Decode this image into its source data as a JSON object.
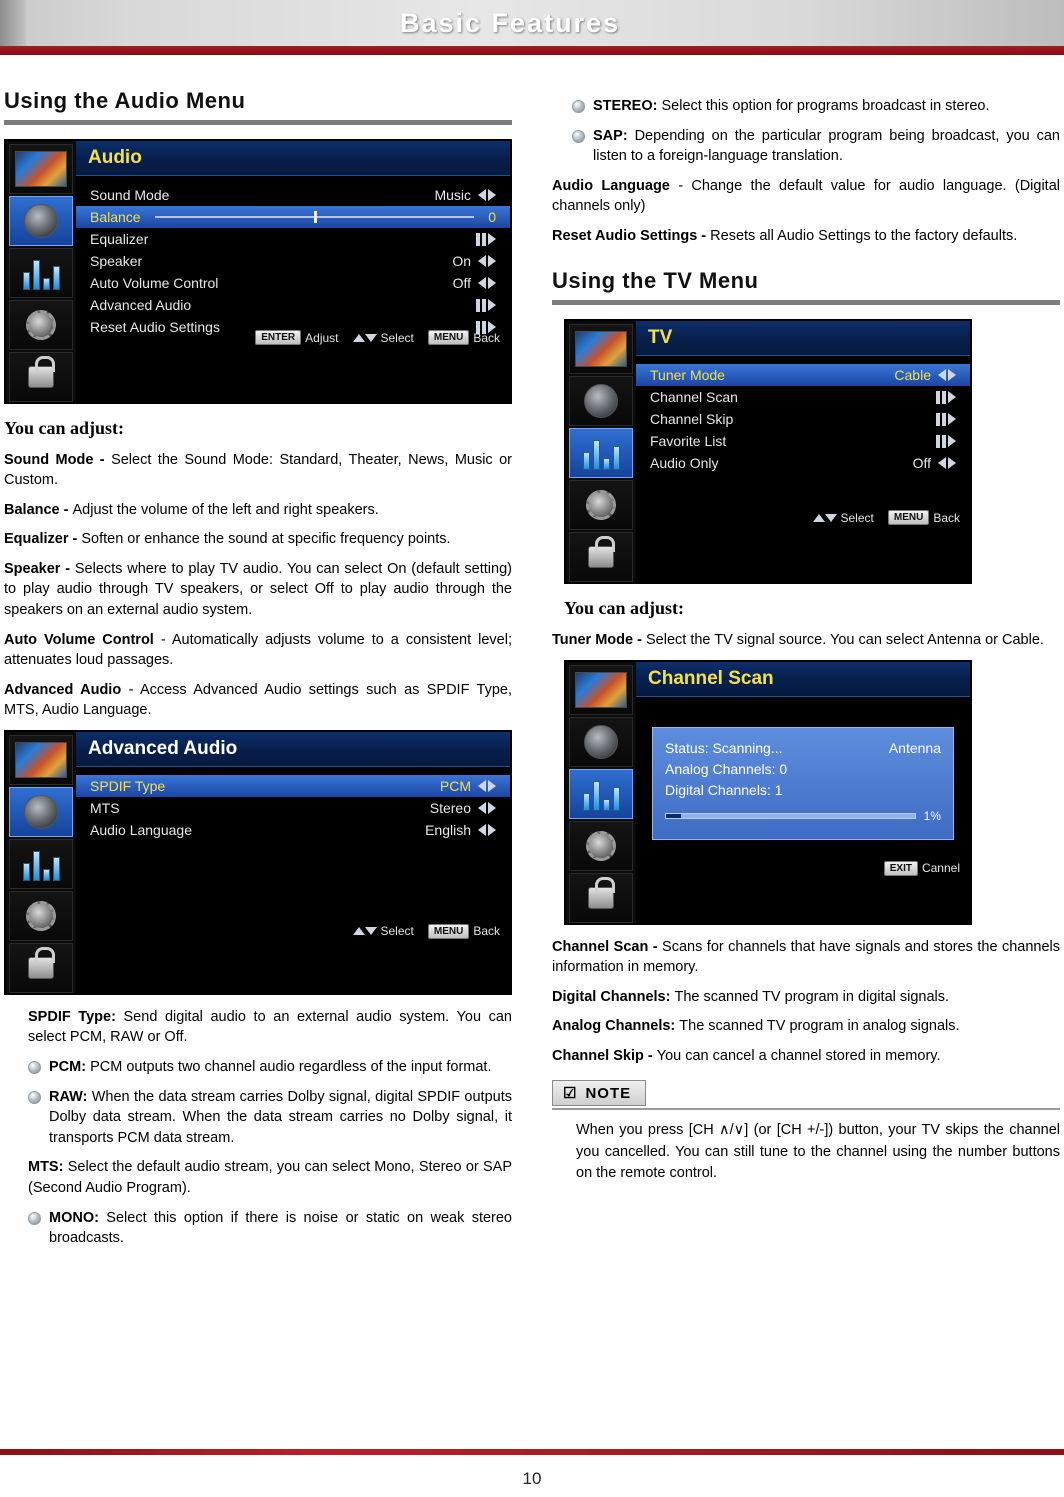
{
  "header": {
    "title": "Basic Features"
  },
  "page_number": "10",
  "left": {
    "section_title": "Using the Audio Menu",
    "audio_osd": {
      "title": "Audio",
      "rows": [
        {
          "label": "Sound Mode",
          "value": "Music",
          "control": "lr-arrows"
        },
        {
          "label": "Balance",
          "value": "0",
          "control": "slider"
        },
        {
          "label": "Equalizer",
          "value": "",
          "control": "bars"
        },
        {
          "label": "Speaker",
          "value": "On",
          "control": "lr-arrows"
        },
        {
          "label": "Auto Volume Control",
          "value": "Off",
          "control": "lr-arrows"
        },
        {
          "label": "Advanced Audio",
          "value": "",
          "control": "bars"
        },
        {
          "label": "Reset Audio Settings",
          "value": "",
          "control": "bars"
        }
      ],
      "footer": [
        {
          "key": "ENTER",
          "label": "Adjust"
        },
        {
          "key": "updown",
          "label": "Select"
        },
        {
          "key": "MENU",
          "label": "Back"
        }
      ]
    },
    "you_can_adjust": "You can adjust:",
    "paragraphs": [
      {
        "bold": "Sound Mode - ",
        "text": "Select the Sound Mode: Standard, Theater, News, Music or Custom."
      },
      {
        "bold": "Balance - ",
        "text": "Adjust the volume of the left and right speakers."
      },
      {
        "bold": "Equalizer - ",
        "text": "Soften or enhance the sound at specific frequency points."
      },
      {
        "bold": "Speaker - ",
        "text": "Selects where to play TV audio. You can select On (default setting) to play audio through TV speakers, or select Off to play audio through the speakers on an external audio system."
      },
      {
        "bold": "Auto Volume Control ",
        "text": "- Automatically adjusts volume to a consistent level; attenuates loud passages."
      },
      {
        "bold": "Advanced Audio ",
        "text": "- Access Advanced Audio settings such as SPDIF Type, MTS, Audio Language."
      }
    ],
    "advanced_osd": {
      "title": "Advanced Audio",
      "rows": [
        {
          "label": "SPDIF Type",
          "value": "PCM",
          "control": "lr-arrows"
        },
        {
          "label": "MTS",
          "value": "Stereo",
          "control": "lr-arrows"
        },
        {
          "label": "Audio Language",
          "value": "English",
          "control": "lr-arrows"
        }
      ],
      "footer": [
        {
          "key": "updown",
          "label": "Select"
        },
        {
          "key": "MENU",
          "label": "Back"
        }
      ]
    },
    "spdif_block": [
      {
        "type": "para",
        "bold": "SPDIF Type: ",
        "text": "Send digital audio to an external audio system. You can select PCM, RAW or Off."
      },
      {
        "type": "bullet",
        "bold": "PCM: ",
        "text": "PCM outputs two channel audio regardless of the input format."
      },
      {
        "type": "bullet",
        "bold": "RAW: ",
        "text": "When the data stream carries Dolby signal, digital SPDIF outputs Dolby data stream. When the data stream carries no Dolby signal, it transports PCM data stream."
      },
      {
        "type": "para",
        "bold": "MTS: ",
        "text": "Select the default audio stream, you can select Mono, Stereo or SAP (Second Audio Program)."
      },
      {
        "type": "bullet",
        "bold": "MONO: ",
        "text": "Select this option if there is noise or static on weak stereo broadcasts."
      }
    ]
  },
  "right": {
    "top_bullets": [
      {
        "bold": "STEREO: ",
        "text": "Select this option for programs broadcast in stereo."
      },
      {
        "bold": "SAP: ",
        "text": "Depending on the particular program being broadcast, you can listen to a foreign-language translation."
      }
    ],
    "audio_language": {
      "bold": "Audio Language ",
      "text": "- Change the default value for audio language. (Digital channels only)"
    },
    "reset_audio": {
      "bold": "Reset Audio Settings - ",
      "text": "Resets all Audio Settings to the factory defaults."
    },
    "section_title": "Using the TV Menu",
    "tv_osd": {
      "title": "TV",
      "rows": [
        {
          "label": "Tuner Mode",
          "value": "Cable",
          "control": "lr-arrows"
        },
        {
          "label": "Channel Scan",
          "value": "",
          "control": "bars"
        },
        {
          "label": "Channel Skip",
          "value": "",
          "control": "bars"
        },
        {
          "label": "Favorite List",
          "value": "",
          "control": "bars"
        },
        {
          "label": "Audio Only",
          "value": "Off",
          "control": "lr-arrows"
        }
      ],
      "footer": [
        {
          "key": "updown",
          "label": "Select"
        },
        {
          "key": "MENU",
          "label": "Back"
        }
      ]
    },
    "you_can_adjust": "You can adjust:",
    "tuner_mode": {
      "bold": "Tuner Mode - ",
      "text": "Select the TV signal source. You can select Antenna or Cable."
    },
    "scan_osd": {
      "title": "Channel Scan",
      "status": "Status: Scanning...",
      "source": "Antenna",
      "analog": "Analog Channels: 0",
      "digital": "Digital Channels: 1",
      "percent": "1%",
      "footer": [
        {
          "key": "EXIT",
          "label": "Cannel"
        }
      ]
    },
    "channel_scan_para": {
      "bold": "Channel Scan - ",
      "text": "Scans for channels that have signals and stores the channels information in memory."
    },
    "scan_items": [
      {
        "bold": "Digital Channels: ",
        "text": "The scanned TV program in digital signals."
      },
      {
        "bold": "Analog Channels: ",
        "text": "The scanned TV program in analog signals."
      }
    ],
    "channel_skip": {
      "bold": "Channel Skip - ",
      "text": "You can cancel a channel stored in memory."
    },
    "note": {
      "icon": "☑",
      "label": "NOTE",
      "text": "When you press [CH ∧/∨] (or [CH +/-]) button, your TV skips the channel you cancelled. You can still tune to the channel using the number buttons on the remote control."
    }
  }
}
